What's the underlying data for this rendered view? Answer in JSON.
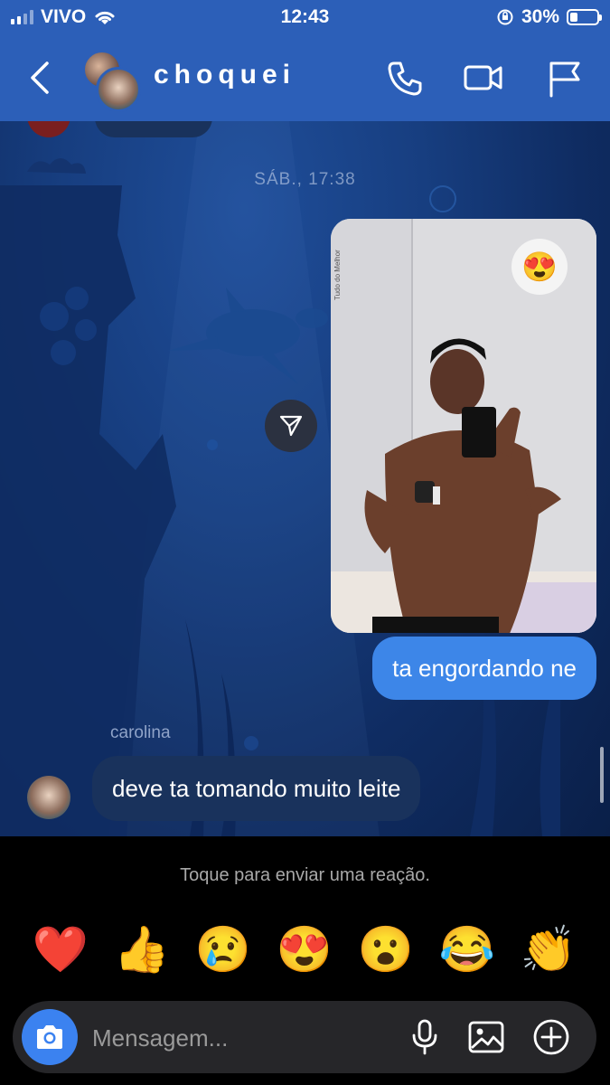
{
  "status_bar": {
    "carrier": "VIVO",
    "time": "12:43",
    "battery_percent_label": "30%",
    "battery_level": 0.3,
    "icons": [
      "signal-icon",
      "wifi-icon",
      "orientation-lock-icon",
      "battery-icon"
    ]
  },
  "header": {
    "title": "choquei",
    "icons": [
      "back-chevron-icon",
      "phone-icon",
      "video-camera-icon",
      "flag-icon"
    ]
  },
  "conversation": {
    "date_separator": "SÁB., 17:38",
    "media_reaction": "😍",
    "outgoing_message": "ta engordando ne",
    "incoming_sender": "carolina",
    "incoming_message": "deve ta tomando muito leite"
  },
  "reaction_panel": {
    "hint": "Toque para enviar uma reação.",
    "emojis": [
      "❤️",
      "👍",
      "😢",
      "😍",
      "😮",
      "😂",
      "👏"
    ]
  },
  "composer": {
    "placeholder": "Mensagem...",
    "icons": [
      "camera-icon",
      "microphone-icon",
      "gallery-icon",
      "add-icon"
    ]
  },
  "colors": {
    "header_bg": "#2c5fb8",
    "outgoing_bubble": "#3d86e8",
    "incoming_bubble": "#19325c",
    "camera_button": "#3b82f0"
  }
}
